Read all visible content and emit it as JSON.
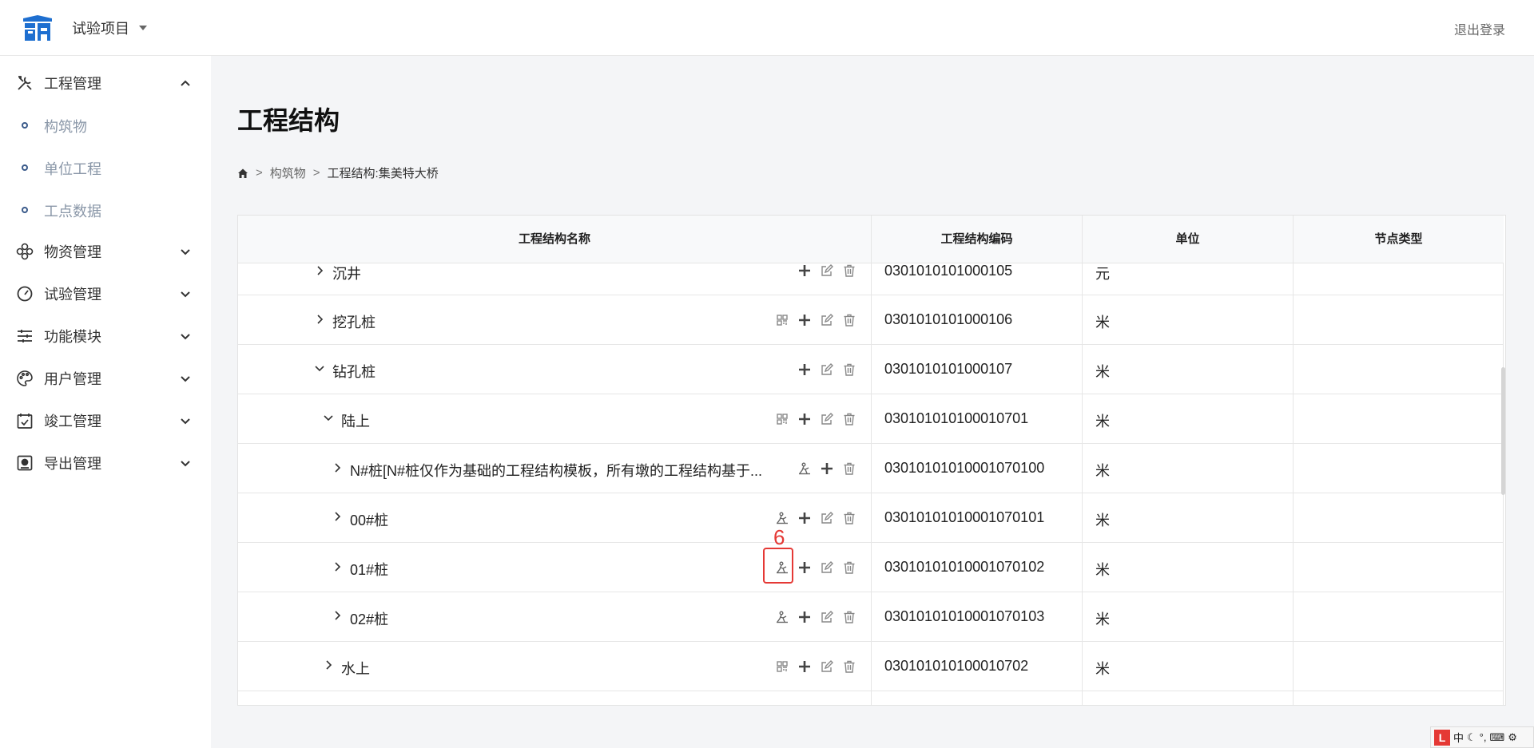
{
  "header": {
    "project_label": "试验项目",
    "logout_label": "退出登录"
  },
  "sidebar": {
    "items": [
      {
        "label": "工程管理",
        "icon": "tools-icon",
        "expanded": true
      },
      {
        "label": "物资管理",
        "icon": "cubes-icon",
        "expanded": false
      },
      {
        "label": "试验管理",
        "icon": "gauge-icon",
        "expanded": false
      },
      {
        "label": "功能模块",
        "icon": "sliders-icon",
        "expanded": false
      },
      {
        "label": "用户管理",
        "icon": "palette-icon",
        "expanded": false
      },
      {
        "label": "竣工管理",
        "icon": "calendar-check-icon",
        "expanded": false
      },
      {
        "label": "导出管理",
        "icon": "export-icon",
        "expanded": false
      }
    ],
    "subitems": [
      {
        "label": "构筑物"
      },
      {
        "label": "单位工程"
      },
      {
        "label": "工点数据"
      }
    ]
  },
  "main": {
    "title": "工程结构",
    "breadcrumb": {
      "link": "构筑物",
      "sep": ">",
      "current": "工程结构:集美特大桥"
    },
    "table": {
      "headers": [
        "工程结构名称",
        "工程结构编码",
        "单位",
        "节点类型"
      ],
      "rows": [
        {
          "name": "沉井",
          "code": "0301010101000105",
          "unit": "元",
          "expanded": false
        },
        {
          "name": "挖孔桩",
          "code": "0301010101000106",
          "unit": "米",
          "expanded": false
        },
        {
          "name": "钻孔桩",
          "code": "0301010101000107",
          "unit": "米",
          "expanded": true
        },
        {
          "name": "陆上",
          "code": "030101010100010701",
          "unit": "米",
          "expanded": true
        },
        {
          "name": "N#桩[N#桩仅作为基础的工程结构模板，所有墩的工程结构基于...",
          "code": "03010101010001070100",
          "unit": "米",
          "expanded": false
        },
        {
          "name": "00#桩",
          "code": "03010101010001070101",
          "unit": "米",
          "expanded": false
        },
        {
          "name": "01#桩",
          "code": "03010101010001070102",
          "unit": "米",
          "expanded": false
        },
        {
          "name": "02#桩",
          "code": "03010101010001070103",
          "unit": "米",
          "expanded": false
        },
        {
          "name": "水上",
          "code": "030101010100010702",
          "unit": "米",
          "expanded": false
        }
      ]
    }
  },
  "annotation": {
    "marker": "6"
  },
  "ime": {
    "label": "中"
  },
  "colors": {
    "accent": "#1e6fd0",
    "highlight": "#e53935"
  }
}
